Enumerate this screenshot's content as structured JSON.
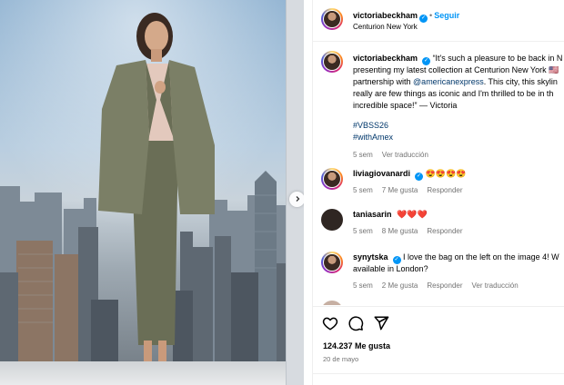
{
  "post_author": {
    "username": "victoriabeckham",
    "follow_label": "Seguir",
    "separator": "•",
    "location": "Centurion New York"
  },
  "caption": {
    "username": "victoriabeckham",
    "lines": [
      "“It's such a pleasure to be back in N",
      "presenting my latest collection at Centurion New York",
      "this city, this skylin",
      "really are few things as iconic and I'm thrilled to be in th",
      "incredible space!” — Victoria"
    ],
    "line3_prefix": "partnership with ",
    "mention": "@americanexpress",
    "line3_suffix": ". This city, this skylin",
    "hashtag_1": "#VBSS26",
    "hashtag_2": "#withAmex",
    "time": "5 sem",
    "translate_label": "Ver traducción"
  },
  "comments": [
    {
      "username": "liviagiovanardi",
      "text": "😍😍😍😍",
      "time": "5 sem",
      "likes": "7 Me gusta",
      "reply": "Responder"
    },
    {
      "username": "taniasarin",
      "text": "❤️❤️❤️",
      "time": "5 sem",
      "likes": "8 Me gusta",
      "reply": "Responder"
    },
    {
      "username": "synytska",
      "line1": "I love the bag on the left on the image 4! W",
      "line2": "available in London?",
      "time": "5 sem",
      "likes": "2 Me gusta",
      "reply": "Responder",
      "translate": "Ver traducción"
    }
  ],
  "stats": {
    "likes": "124.237 Me gusta",
    "date": "20 de mayo"
  },
  "colors": {
    "accent": "#0095f6",
    "link": "#00376b",
    "muted": "#737373"
  },
  "icons": [
    "heart-icon",
    "comment-icon",
    "share-icon",
    "chevron-right-icon",
    "verified-icon"
  ]
}
